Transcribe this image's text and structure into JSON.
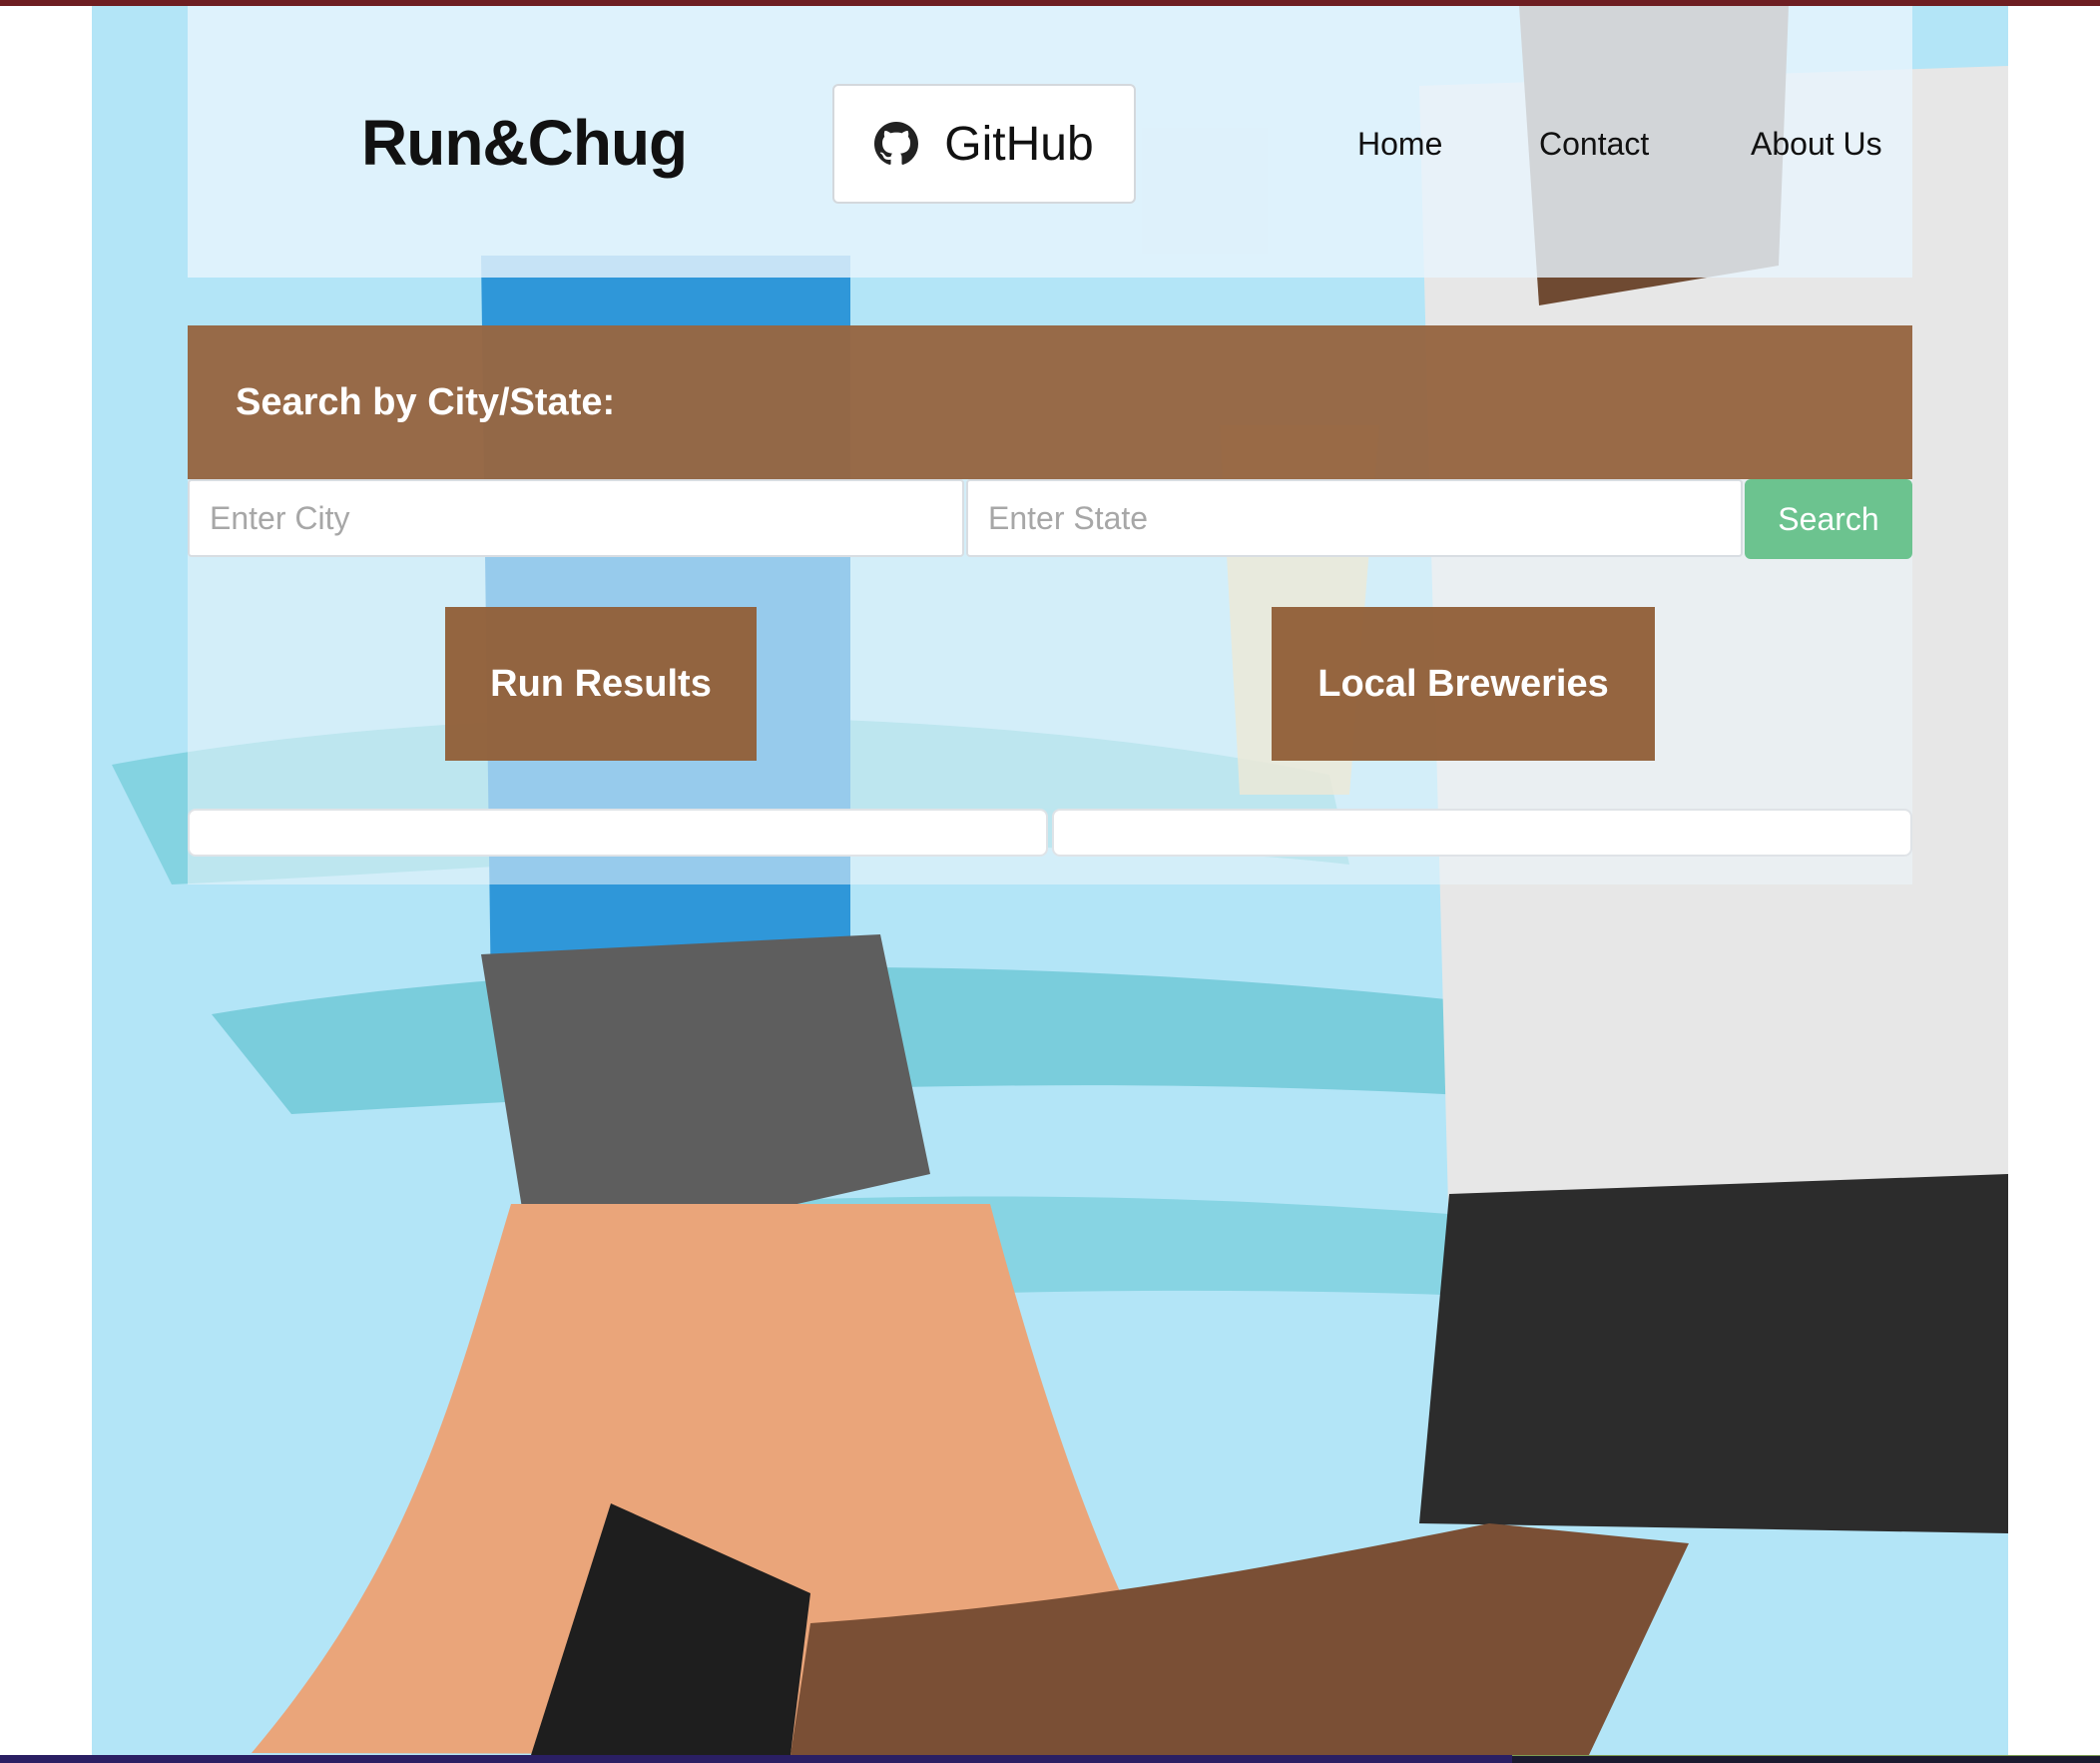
{
  "header": {
    "brand": "Run&Chug",
    "github_label": "GitHub",
    "github_icon": "github-icon",
    "nav": [
      "Home",
      "Contact",
      "About Us"
    ]
  },
  "search": {
    "title": "Search by City/State:",
    "city_placeholder": "Enter City",
    "city_value": "",
    "state_placeholder": "Enter State",
    "state_value": "",
    "button_label": "Search"
  },
  "tabs": {
    "run_label": "Run Results",
    "brew_label": "Local Breweries"
  },
  "colors": {
    "accent_brown": "#92603a",
    "search_green": "#6cc38f",
    "background_blue": "#b3e5f7",
    "top_bar": "#6e1e22"
  }
}
